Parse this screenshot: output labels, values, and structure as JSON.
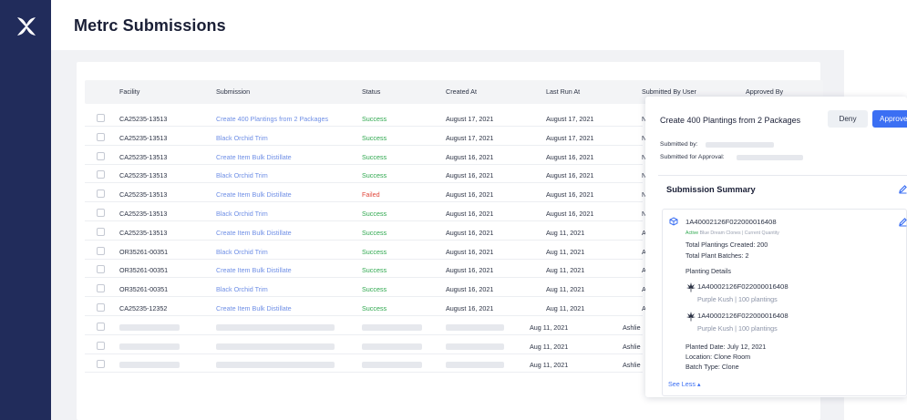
{
  "page": {
    "title": "Metrc Submissions"
  },
  "colors": {
    "sidebar": "#212c5b",
    "success": "#2fa84f",
    "failed": "#e0473b",
    "link": "#6f8fe6",
    "primary": "#3b6ff3"
  },
  "table": {
    "headers": {
      "facility": "Facility",
      "submission": "Submission",
      "status": "Status",
      "created_at": "Created At",
      "last_run_at": "Last Run At",
      "submitted_by": "Submitted By User",
      "approved_by": "Approved By"
    },
    "rows": [
      {
        "facility": "CA25235-13513",
        "submission": "Create 400 Plantings from 2 Packages",
        "status": "Success",
        "created": "August 17, 2021",
        "last_run": "August 17, 2021",
        "user": "N"
      },
      {
        "facility": "CA25235-13513",
        "submission": "Black Orchid Trim",
        "status": "Success",
        "created": "August 17, 2021",
        "last_run": "August 17, 2021",
        "user": "N"
      },
      {
        "facility": "CA25235-13513",
        "submission": "Create Item Bulk Distillate",
        "status": "Success",
        "created": "August 16, 2021",
        "last_run": "August 16, 2021",
        "user": "N"
      },
      {
        "facility": "CA25235-13513",
        "submission": "Black Orchid Trim",
        "status": "Success",
        "created": "August 16, 2021",
        "last_run": "August 16, 2021",
        "user": "N"
      },
      {
        "facility": "CA25235-13513",
        "submission": "Create Item Bulk Distillate",
        "status": "Failed",
        "created": "August 16, 2021",
        "last_run": "August 16, 2021",
        "user": "N"
      },
      {
        "facility": "CA25235-13513",
        "submission": "Black Orchid Trim",
        "status": "Success",
        "created": "August 16, 2021",
        "last_run": "August 16, 2021",
        "user": "N"
      },
      {
        "facility": "CA25235-13513",
        "submission": "Create Item Bulk Distillate",
        "status": "Success",
        "created": "August 16, 2021",
        "last_run": "Aug 11, 2021",
        "user": "A"
      },
      {
        "facility": "OR35261-00351",
        "submission": "Black Orchid Trim",
        "status": "Success",
        "created": "August 16, 2021",
        "last_run": "Aug 11, 2021",
        "user": "A"
      },
      {
        "facility": "OR35261-00351",
        "submission": "Create Item Bulk Distillate",
        "status": "Success",
        "created": "August 16, 2021",
        "last_run": "Aug 11, 2021",
        "user": "A"
      },
      {
        "facility": "OR35261-00351",
        "submission": "Black Orchid Trim",
        "status": "Success",
        "created": "August 16, 2021",
        "last_run": "Aug 11, 2021",
        "user": "A"
      },
      {
        "facility": "CA25235-12352",
        "submission": "Create Item Bulk Distillate",
        "status": "Success",
        "created": "August 16, 2021",
        "last_run": "Aug 11, 2021",
        "user": "A"
      }
    ],
    "loading_rows": [
      {
        "last_run": "Aug 11, 2021",
        "user": "Ashlie"
      },
      {
        "last_run": "Aug 11, 2021",
        "user": "Ashlie"
      },
      {
        "last_run": "Aug 11, 2021",
        "user": "Ashlie"
      }
    ]
  },
  "panel": {
    "title": "Create 400 Plantings from 2 Packages",
    "deny_label": "Deny",
    "approve_label": "Approve",
    "submitted_by_label": "Submitted by:",
    "submitted_for_approval_label": "Submitted for Approval:",
    "summary_title": "Submission Summary",
    "package": {
      "tag": "1A40002126F022000016408",
      "status": "Active",
      "strain_info": "Blue Dream Clones | Current Quantity",
      "total_plantings": "Total Plantings Created: 200",
      "total_batches": "Total Plant Batches: 2"
    },
    "planting_details_label": "Planting Details",
    "plantings": [
      {
        "tag": "1A40002126F022000016408",
        "detail": "Purple Kush | 100 plantings"
      },
      {
        "tag": "1A40002126F022000016408",
        "detail": "Purple Kush | 100 plantings"
      }
    ],
    "planted_date": "Planted Date: July 12, 2021",
    "location": "Location: Clone Room",
    "batch_type": "Batch Type: Clone",
    "see_less_label": "See Less"
  }
}
